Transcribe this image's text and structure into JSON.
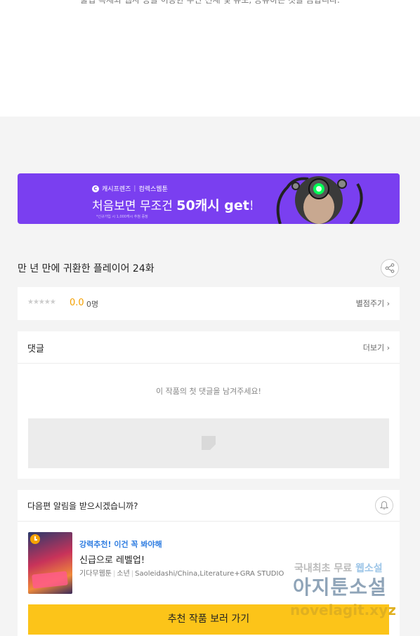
{
  "top": {
    "cut_text": "불법 복제와 웹사 등을 이용한 무단 전재 및 유포, 공유하는 것을 금합니다."
  },
  "banner": {
    "brand": "캐시프렌즈",
    "partner": "컴렉스웹툰",
    "headline_prefix": "처음보면 무조건 ",
    "headline_highlight": "50캐시 get!!",
    "fine_print": "*신규가입 시 1,000캐시 추첨 증정"
  },
  "episode": {
    "title": "만 년 만에 귀환한 플레이어 24화"
  },
  "rating": {
    "stars": "★★★★★",
    "score": "0.0",
    "count": "0명",
    "link": "별점주기 ›"
  },
  "comments": {
    "title": "댓글",
    "more": "더보기 ›",
    "empty": "이 작품의 첫 댓글을 남겨주세요!"
  },
  "next": {
    "question": "다음편 알림을 받으시겠습니까?",
    "tag": "강력추천! 이건 꼭 봐야해",
    "name": "신급으로 레벨업!",
    "meta_platform": "기다무웹툰",
    "meta_genre": "소년",
    "meta_author": "Saoleidashi/China,Literature+GRA STUDIO",
    "cta": "추천 작품 보러 가기"
  },
  "watermark": {
    "line1_prefix": "국내최초 무료 ",
    "line1_highlight": "웹소설",
    "line2": "아지툰소설",
    "line3": "novelagit.xyz"
  },
  "colors": {
    "banner": "#7a3ff0",
    "accent_score": "#f5a000",
    "tag_blue": "#2f7de1",
    "cta_yellow": "#fcc419"
  }
}
